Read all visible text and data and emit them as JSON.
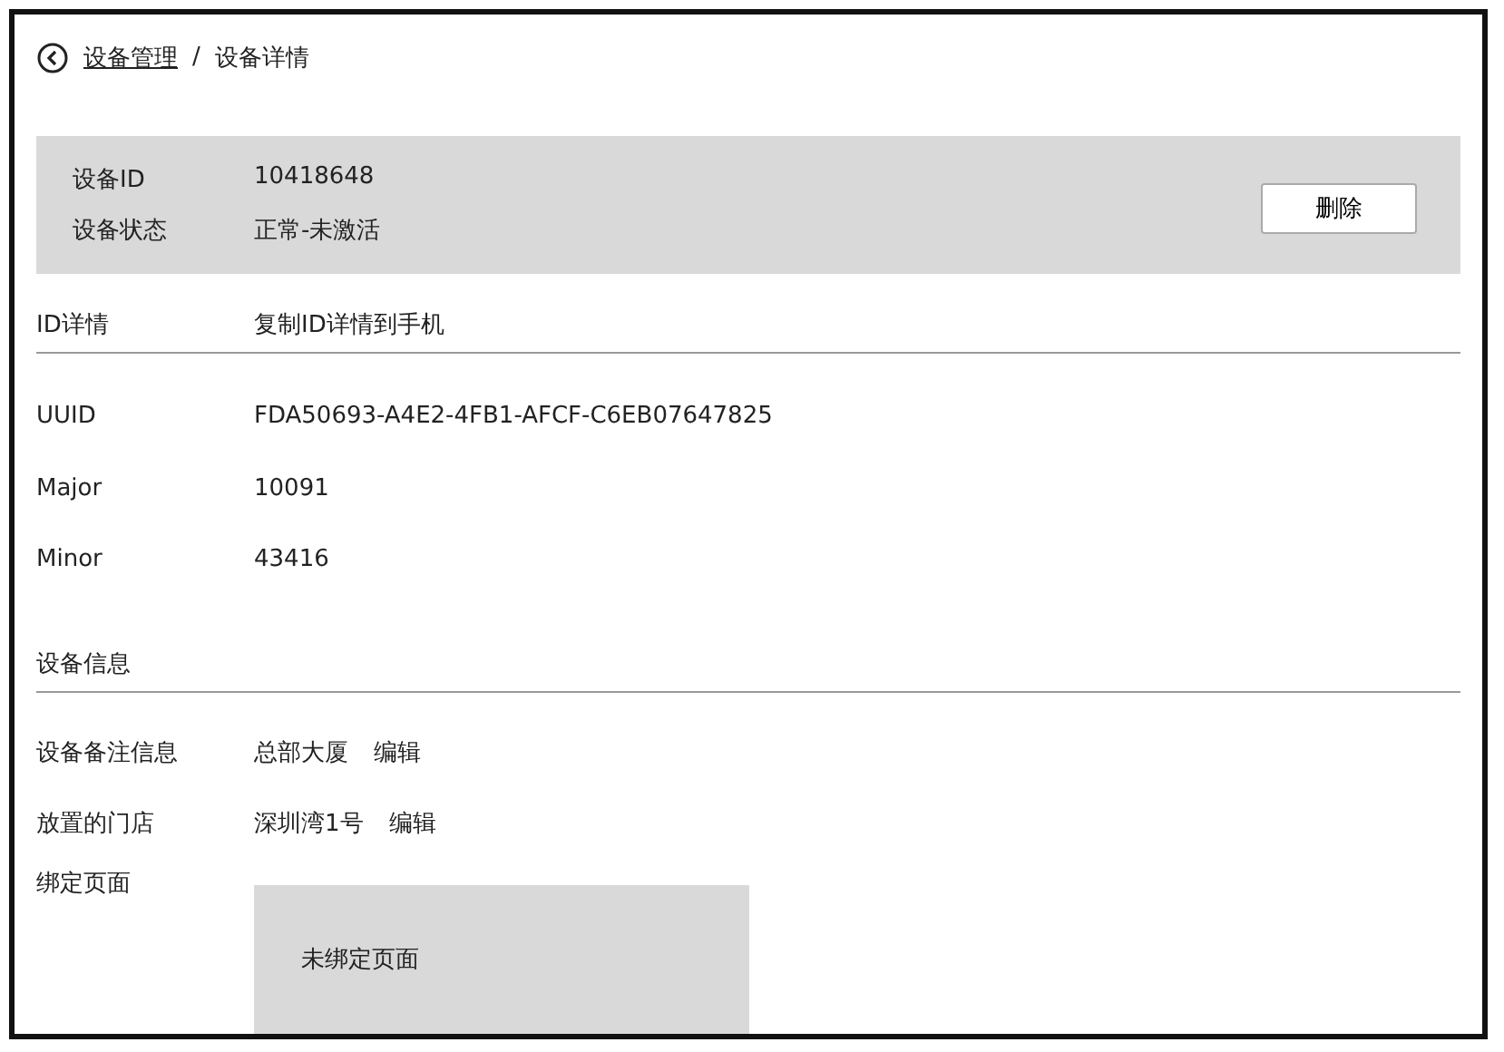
{
  "breadcrumb": {
    "parent": "设备管理",
    "separator": "/",
    "current": "设备详情"
  },
  "summary": {
    "rows": [
      {
        "label": "设备ID",
        "value": "10418648"
      },
      {
        "label": "设备状态",
        "value": "正常-未激活"
      }
    ],
    "delete_button": "删除"
  },
  "id_section": {
    "title": "ID详情",
    "action": "复制ID详情到手机",
    "rows": [
      {
        "label": "UUID",
        "value": "FDA50693-A4E2-4FB1-AFCF-C6EB07647825"
      },
      {
        "label": "Major",
        "value": "10091"
      },
      {
        "label": "Minor",
        "value": "43416"
      }
    ]
  },
  "info_section": {
    "title": "设备信息",
    "rows": [
      {
        "label": "设备备注信息",
        "value": "总部大厦",
        "edit": "编辑"
      },
      {
        "label": "放置的门店",
        "value": "深圳湾1号",
        "edit": "编辑"
      }
    ],
    "bound_page": {
      "label": "绑定页面",
      "value": "未绑定页面"
    }
  }
}
